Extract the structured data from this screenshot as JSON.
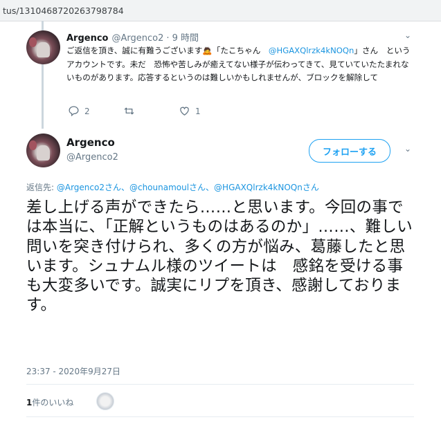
{
  "browser": {
    "url": "tus/1310468720263798784"
  },
  "reply": {
    "name": "Argenco",
    "handle": "@Argenco2",
    "time": "· 9 時間",
    "text_prefix": "ご返信を頂き、誠に有難うございます",
    "emoji": "🙇",
    "text_quote": "「たこちゃん　",
    "mention": "@HGAXQlrzk4kNOQn",
    "text_rest": "」さん　というアカウントです。未だ　恐怖や苦しみが癒えてない様子が伝わってきて、見ていていたたまれないものがあります。応答するというのは難しいかもしれませんが、ブロックを解除して",
    "reply_count": "2",
    "retweet_count": "",
    "like_count": "1"
  },
  "main_tweet": {
    "name": "Argenco",
    "handle": "@Argenco2",
    "follow_label": "フォローする",
    "reply_to_prefix": "返信先: ",
    "reply_to_mentions": "@Argenco2さん、@chounamoulさん、@HGAXQlrzk4kNOQnさん",
    "text": "差し上げる声ができたら……と思います。今回の事では本当に、「正解というものはあるのか」……、難しい問いを突き付けられ、多くの方が悩み、葛藤したと思います。シュナムル様のツイートは　感銘を受ける事も大変多いです。誠実にリプを頂き、感謝しております。",
    "timestamp": "23:37 - 2020年9月27日",
    "likes_count": "1",
    "likes_suffix": "件のいいね"
  },
  "colors": {
    "accent": "#1da1f2",
    "mention": "#1b95e0",
    "muted": "#657786"
  }
}
